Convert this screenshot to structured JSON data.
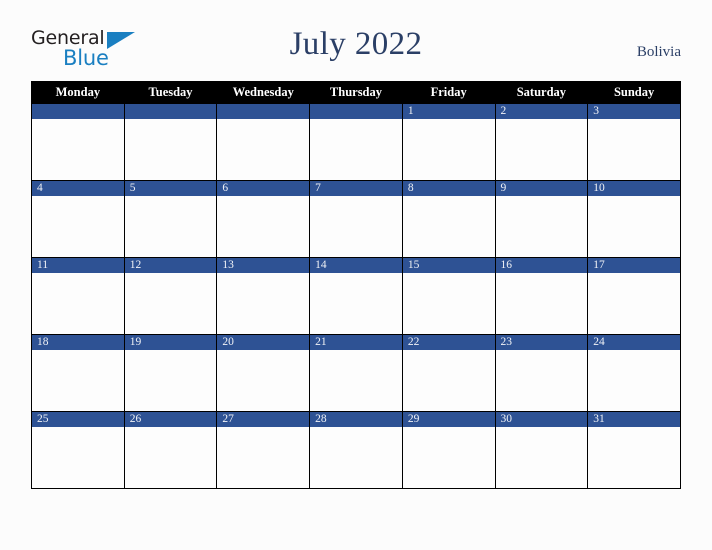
{
  "brand": {
    "line1": "General",
    "line2": "Blue",
    "triangle_color": "#1a7fc1",
    "line1_color": "#231f20",
    "icon": "blue-triangle-icon"
  },
  "header": {
    "title": "July 2022",
    "region": "Bolivia",
    "title_color": "#2b3f66"
  },
  "calendar": {
    "weekday_headers": [
      "Monday",
      "Tuesday",
      "Wednesday",
      "Thursday",
      "Friday",
      "Saturday",
      "Sunday"
    ],
    "header_bg": "#000000",
    "header_text_color": "#ffffff",
    "day_bar_bg": "#2e5294",
    "day_bar_text_color": "#f0f2f6",
    "cell_bg": "#fdfdfd",
    "border_color": "#000000",
    "weeks": [
      [
        "",
        "",
        "",
        "",
        "1",
        "2",
        "3"
      ],
      [
        "4",
        "5",
        "6",
        "7",
        "8",
        "9",
        "10"
      ],
      [
        "11",
        "12",
        "13",
        "14",
        "15",
        "16",
        "17"
      ],
      [
        "18",
        "19",
        "20",
        "21",
        "22",
        "23",
        "24"
      ],
      [
        "25",
        "26",
        "27",
        "28",
        "29",
        "30",
        "31"
      ]
    ]
  }
}
